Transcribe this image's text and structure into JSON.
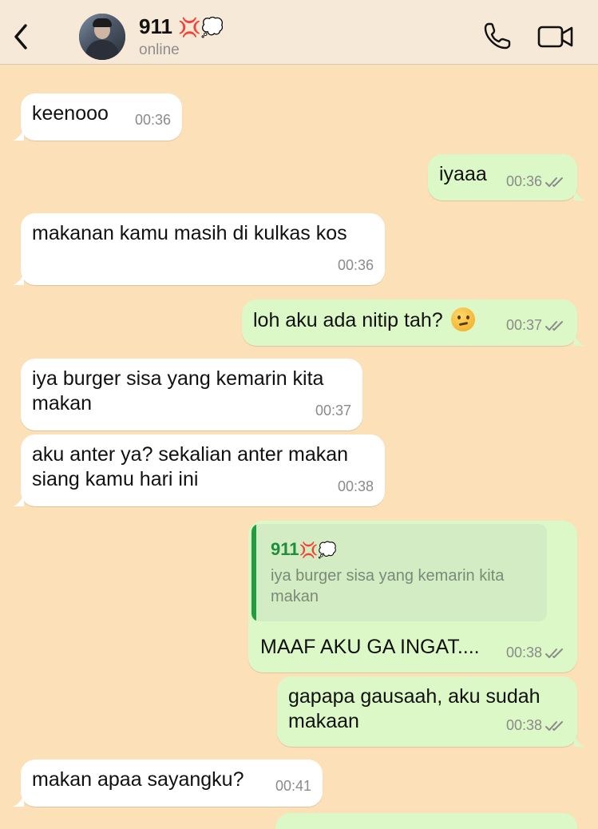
{
  "header": {
    "contact_name": "911",
    "name_emoji": "💢💭",
    "status": "online"
  },
  "messages": [
    {
      "direction": "in",
      "text": "keenooo",
      "time": "00:36"
    },
    {
      "direction": "out",
      "text": "iyaaa",
      "time": "00:36",
      "read": true
    },
    {
      "direction": "in",
      "text": "makanan kamu masih di kulkas kos",
      "time": "00:36"
    },
    {
      "direction": "out",
      "text": "loh aku ada nitip tah?",
      "emoji": "thinking-face",
      "time": "00:37",
      "read": true
    },
    {
      "direction": "in",
      "text_lines": [
        "iya burger sisa yang kemarin kita",
        "makan"
      ],
      "time": "00:37"
    },
    {
      "direction": "in",
      "text_lines": [
        "aku anter ya? sekalian anter makan",
        "siang kamu hari ini"
      ],
      "time": "00:38"
    },
    {
      "direction": "out",
      "reply_to": {
        "name": "911",
        "name_emoji": "💢💭",
        "text_lines": [
          "iya burger sisa yang kemarin kita",
          "makan"
        ]
      },
      "text": "MAAF AKU GA INGAT....",
      "time": "00:38",
      "read": true
    },
    {
      "direction": "out",
      "text_lines": [
        "gapapa gausaah, aku sudah",
        "makaan"
      ],
      "time": "00:38",
      "read": true
    },
    {
      "direction": "in",
      "text": "makan apaa sayangku?",
      "time": "00:41"
    }
  ],
  "colors": {
    "chat_background": "#fbe0b8",
    "header_background": "#f7e9d7",
    "incoming_bubble": "#ffffff",
    "outgoing_bubble": "#dcf8c6",
    "reply_accent": "#1f9d40",
    "read_ticks": "#8a8a8a"
  },
  "icons": [
    "back-chevron-icon",
    "phone-call-icon",
    "video-call-icon",
    "double-check-icon",
    "thinking-face-emoji"
  ]
}
